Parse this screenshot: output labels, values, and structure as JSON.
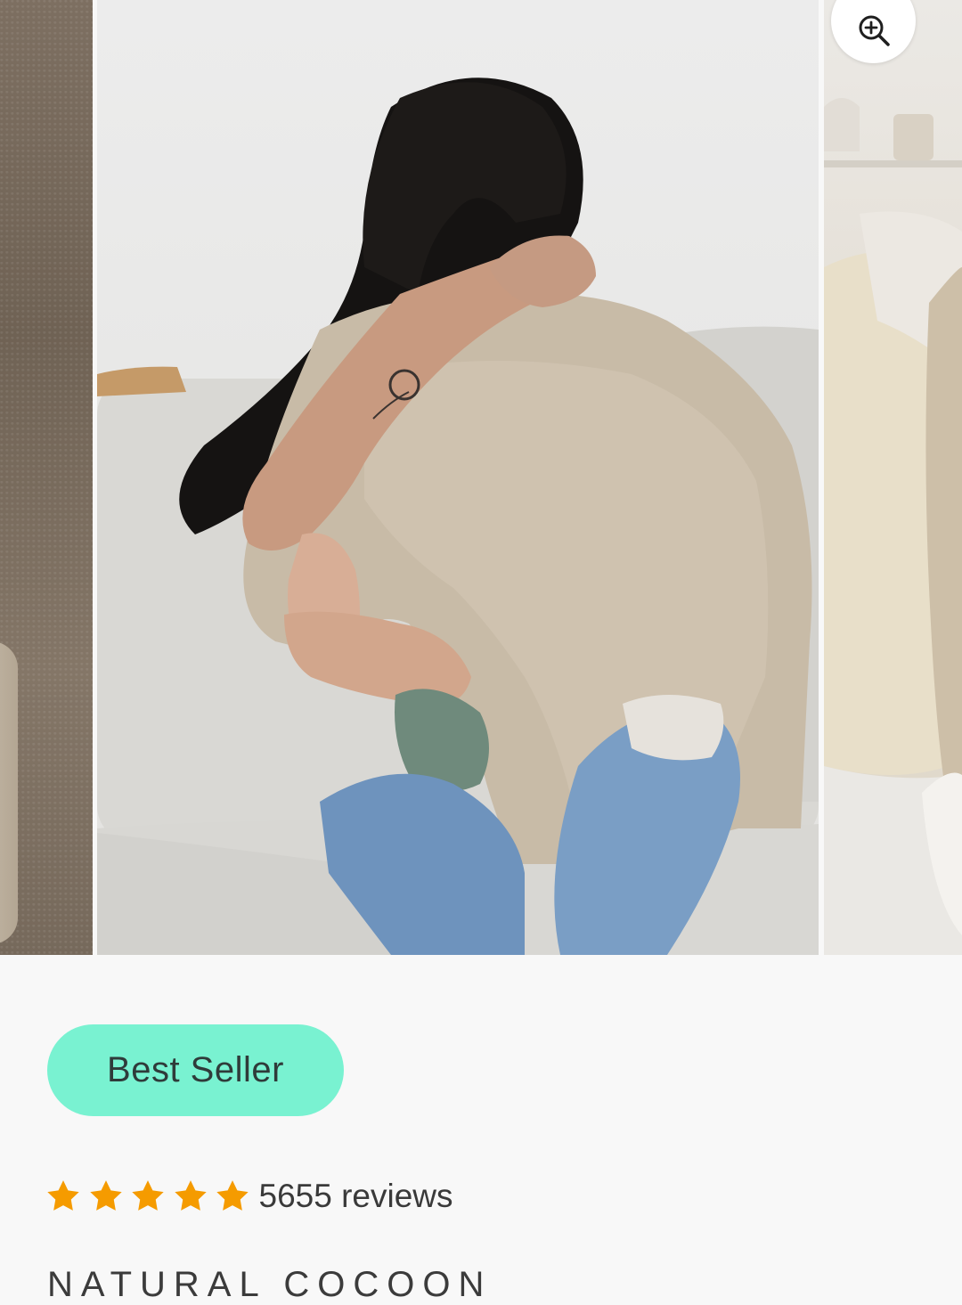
{
  "gallery": {
    "slides": [
      {
        "name": "previous-product-image"
      },
      {
        "name": "current-product-image"
      },
      {
        "name": "next-product-image"
      }
    ],
    "zoom_icon": "zoom-in-icon"
  },
  "product": {
    "badge": "Best Seller",
    "rating": {
      "stars": 5,
      "star_color": "#f59b00",
      "review_count": "5655 reviews"
    },
    "title": "NATURAL COCOON"
  },
  "colors": {
    "background": "#f8f8f8",
    "badge_bg": "#79f2d1",
    "text": "#3a3a3a"
  }
}
